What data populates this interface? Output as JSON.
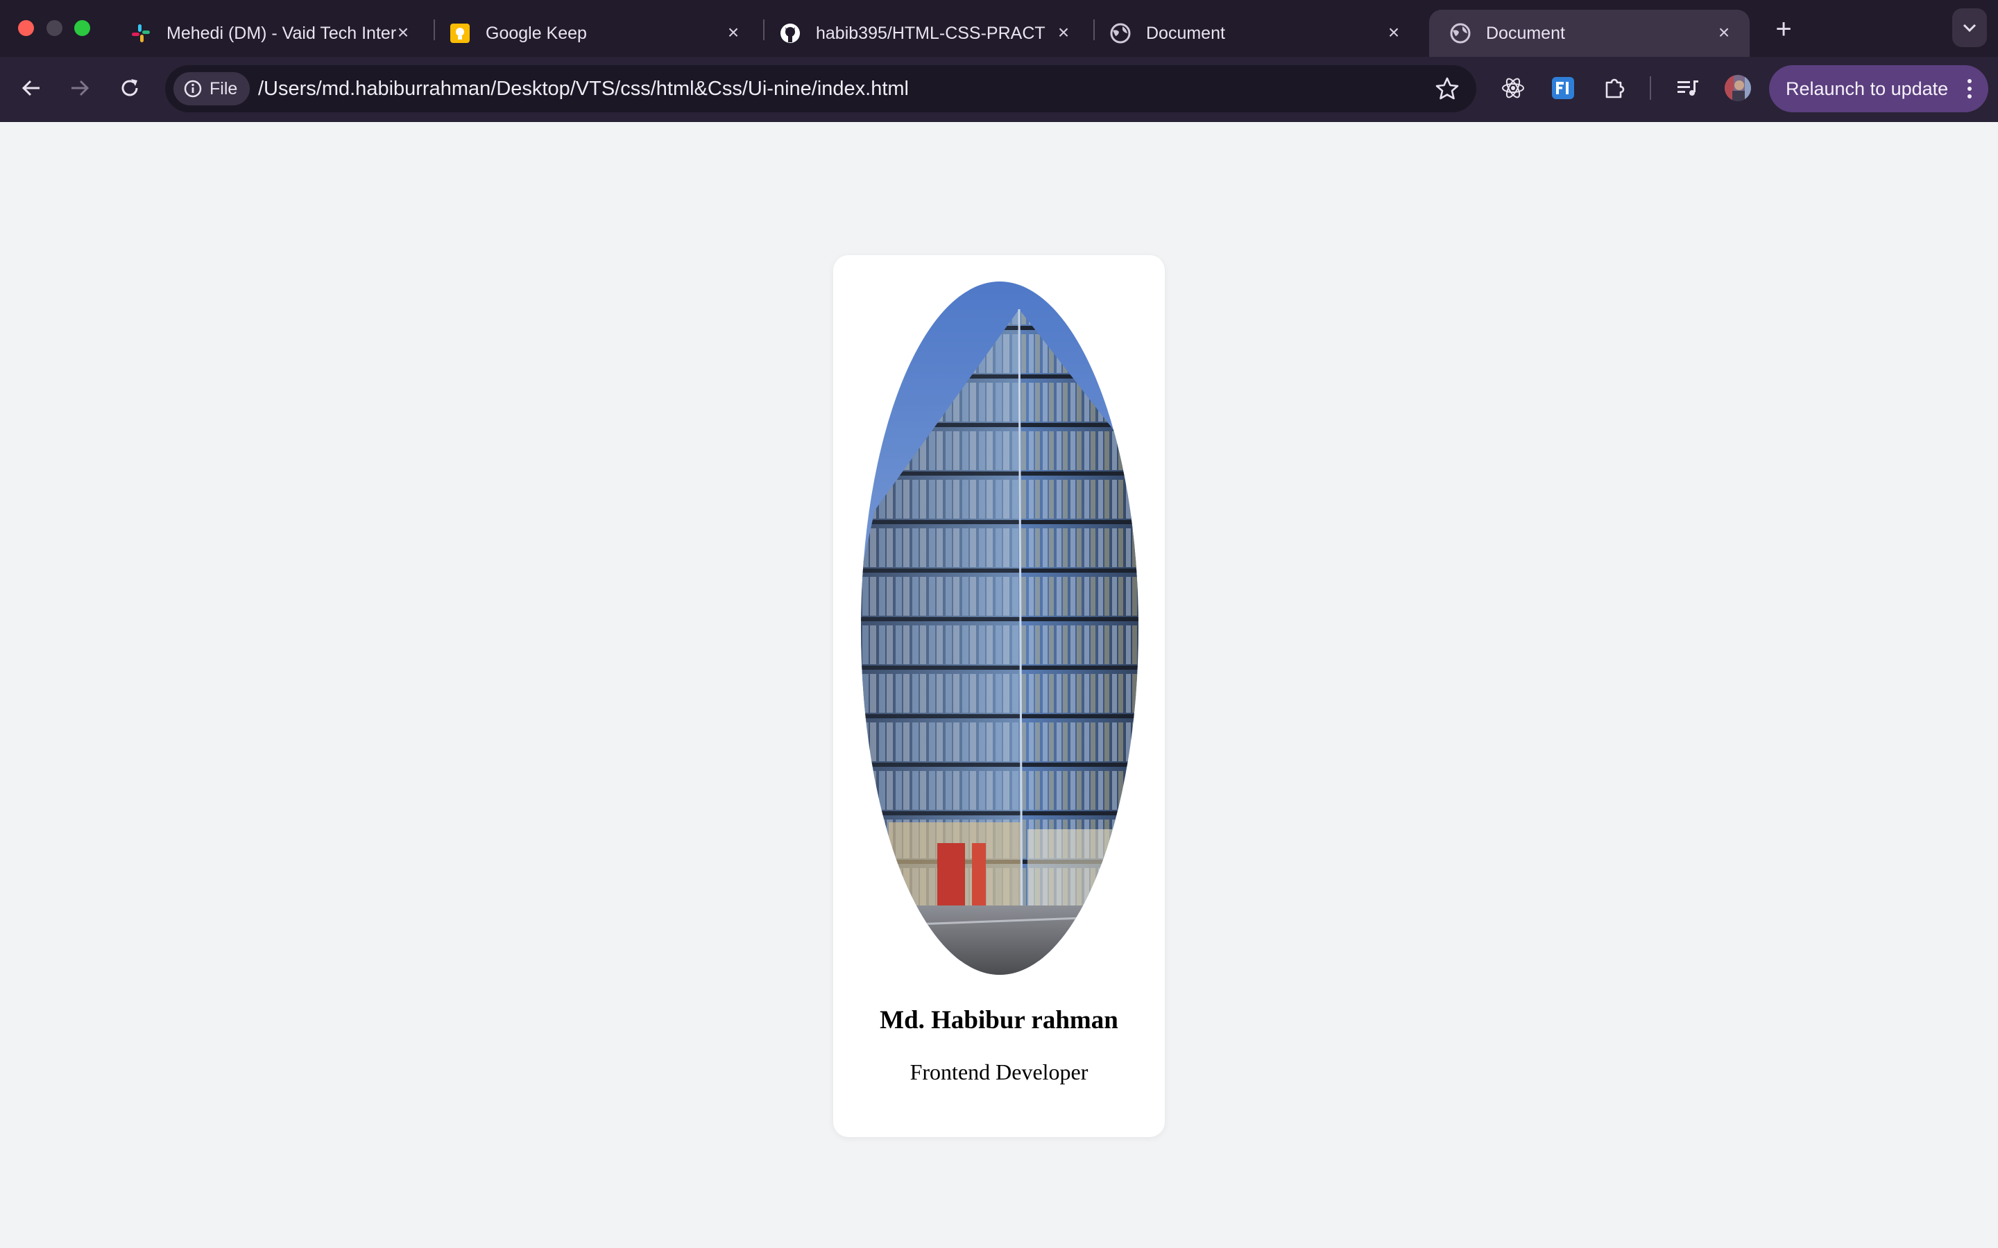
{
  "browser": {
    "tabs": [
      {
        "title": "Mehedi (DM) - Vaid Tech Inter",
        "favicon": "slack-icon"
      },
      {
        "title": "Google Keep",
        "favicon": "google-keep-icon"
      },
      {
        "title": "habib395/HTML-CSS-PRACT",
        "favicon": "github-icon"
      },
      {
        "title": "Document",
        "favicon": "globe-icon"
      },
      {
        "title": "Document",
        "favicon": "globe-icon",
        "active": true
      }
    ],
    "address": {
      "chip_label": "File",
      "url": "/Users/md.habiburrahman/Desktop/VTS/css/html&Css/Ui-nine/index.html"
    },
    "relaunch_label": "Relaunch to update",
    "colors": {
      "frame": "#211b2b",
      "toolbar": "#2a2236",
      "relaunch": "#5b3f7e"
    }
  },
  "page": {
    "card": {
      "name": "Md. Habibur rahman",
      "role": "Frontend Developer"
    },
    "background": "#f2f3f5"
  }
}
